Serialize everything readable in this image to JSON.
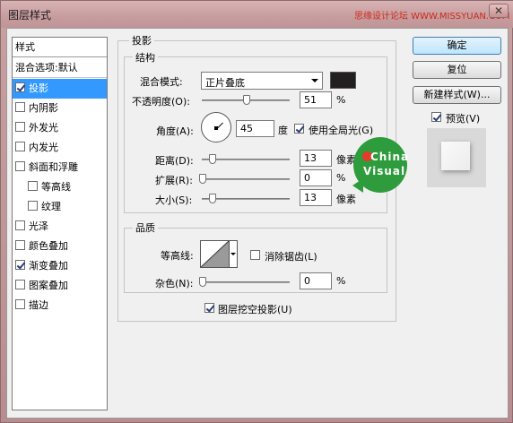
{
  "window": {
    "title": "图层样式",
    "watermark": "思缘设计论坛 WWW.MISSYUAN.COM",
    "close_glyph": "✕"
  },
  "style_list": {
    "header": "样式",
    "blend_default": "混合选项:默认",
    "items": [
      {
        "label": "投影",
        "checked": true,
        "selected": true
      },
      {
        "label": "内阴影",
        "checked": false
      },
      {
        "label": "外发光",
        "checked": false
      },
      {
        "label": "内发光",
        "checked": false
      },
      {
        "label": "斜面和浮雕",
        "checked": false
      },
      {
        "label": "等高线",
        "checked": false,
        "indent": true
      },
      {
        "label": "纹理",
        "checked": false,
        "indent": true
      },
      {
        "label": "光泽",
        "checked": false
      },
      {
        "label": "颜色叠加",
        "checked": false
      },
      {
        "label": "渐变叠加",
        "checked": true
      },
      {
        "label": "图案叠加",
        "checked": false
      },
      {
        "label": "描边",
        "checked": false
      }
    ]
  },
  "drop_shadow": {
    "group_title": "投影",
    "structure": {
      "title": "结构",
      "blend_mode_label": "混合模式:",
      "blend_mode_value": "正片叠底",
      "shadow_color": "#231f20",
      "opacity_label": "不透明度(O):",
      "opacity_value": "51",
      "opacity_unit": "%",
      "opacity_level": 51,
      "angle_label": "角度(A):",
      "angle_value": "45",
      "angle_unit": "度",
      "global_light_label": "使用全局光(G)",
      "global_light_checked": true,
      "distance_label": "距离(D):",
      "distance_value": "13",
      "distance_unit": "像素",
      "spread_label": "扩展(R):",
      "spread_value": "0",
      "spread_unit": "%",
      "size_label": "大小(S):",
      "size_value": "13",
      "size_unit": "像素"
    },
    "quality": {
      "title": "品质",
      "contour_label": "等高线:",
      "antialias_label": "消除锯齿(L)",
      "antialias_checked": false,
      "noise_label": "杂色(N):",
      "noise_value": "0",
      "noise_unit": "%"
    },
    "knockout_label": "图层挖空投影(U)",
    "knockout_checked": true
  },
  "buttons": {
    "ok": "确定",
    "reset": "复位",
    "new_style": "新建样式(W)...",
    "preview_label": "预览(V)",
    "preview_checked": true
  },
  "logo": {
    "line1": "China",
    "line2": "Visual",
    "color": "#2e9c3c"
  }
}
